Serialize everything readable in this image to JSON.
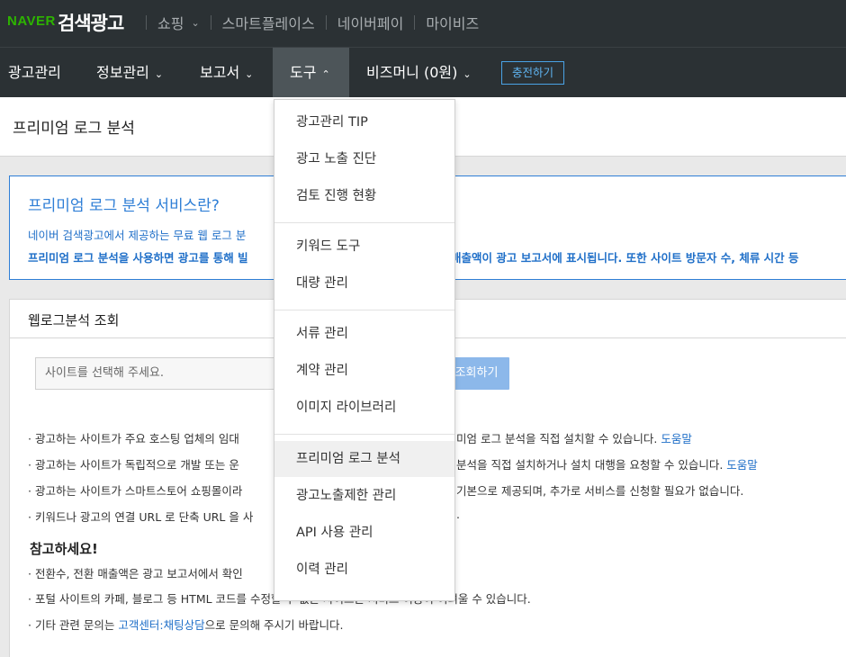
{
  "brand": {
    "naver": "NAVER",
    "title": "검색광고"
  },
  "top_nav": [
    {
      "label": "쇼핑"
    },
    {
      "label": "스마트플레이스"
    },
    {
      "label": "네이버페이"
    },
    {
      "label": "마이비즈"
    }
  ],
  "main_nav": {
    "ad_manage": "광고관리",
    "info_manage": "정보관리",
    "report": "보고서",
    "tools": "도구",
    "bizmoney": "비즈머니 (0원)",
    "charge": "충전하기"
  },
  "page": {
    "title": "프리미엄 로그 분석"
  },
  "info_box": {
    "title": "프리미엄 로그 분석 서비스란?",
    "line1": "네이버 검색광고에서 제공하는 무료 웹 로그 분",
    "line2a": "프리미엄 로그 분석을 사용하면 광고를 통해 빌",
    "line2b": "매출액이 광고 보고서에 표시됩니다. 또한 사이트 방문자 수, 체류 시간 등"
  },
  "panel": {
    "title": "웹로그분석 조회",
    "select_placeholder": "사이트를 선택해 주세요.",
    "search_button": "조회하기"
  },
  "bullets": [
    {
      "left": "· 광고하는 사이트가 주요 호스팅 업체의 임대",
      "right": "미엄 로그 분석을 직접 설치할 수 있습니다.",
      "link": "도움말"
    },
    {
      "left": "· 광고하는 사이트가 독립적으로 개발 또는 운",
      "right": "분석을 직접 설치하거나 설치 대행을 요청할 수 있습니다.",
      "link": "도움말"
    },
    {
      "left": "· 광고하는 사이트가 스마트스토어 쇼핑몰이라",
      "right": "기본으로 제공되며, 추가로 서비스를 신청할 필요가 없습니다.",
      "link": ""
    },
    {
      "left": "· 키워드나 광고의 연결 URL 로 단축 URL 을 사",
      "right": ".",
      "link": ""
    }
  ],
  "note": {
    "title": "참고하세요!",
    "line1_left": "· 전환수, 전환 매출액은 광고 보고서에서 확인",
    "line2": "· 포털 사이트의 카페, 블로그 등 HTML 코드를 수정할 수 없는 사이트는 서비스 이용이 어려울 수 있습니다.",
    "line3_pre": "· 기타 관련 문의는 ",
    "line3_link": "고객센터:채팅상담",
    "line3_post": "으로 문의해 주시기 바랍니다."
  },
  "tools_menu": {
    "items": [
      "광고관리 TIP",
      "광고 노출 진단",
      "검토 진행 현황",
      "키워드 도구",
      "대량 관리",
      "서류 관리",
      "계약 관리",
      "이미지 라이브러리",
      "프리미엄 로그 분석",
      "광고노출제한 관리",
      "API 사용 관리",
      "이력 관리"
    ],
    "selected": "프리미엄 로그 분석"
  },
  "colors": {
    "topbar": "#2b3134",
    "accent": "#2e7ed6",
    "naver_green": "#2db400",
    "button": "#8cb8ea"
  }
}
